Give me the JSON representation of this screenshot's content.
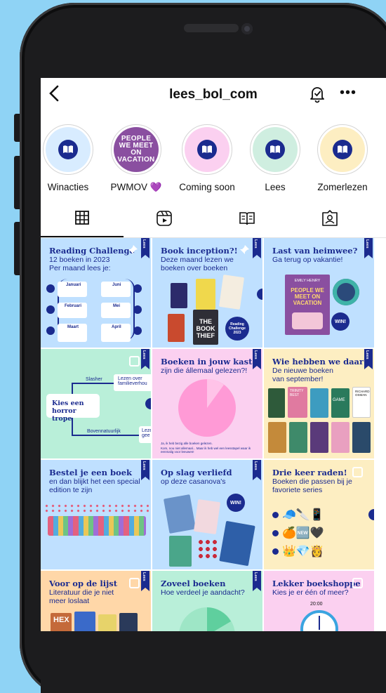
{
  "header": {
    "handle": "lees_bol_com"
  },
  "highlights": [
    {
      "label": "Winacties",
      "bg": "#d8ecff"
    },
    {
      "label": "PWMOV 💜",
      "bg": "#8a4fa0",
      "cover_text": "PEOPLE WE MEET ON VACATION"
    },
    {
      "label": "Coming soon",
      "bg": "#fbd0f0"
    },
    {
      "label": "Lees",
      "bg": "#cfeee0"
    },
    {
      "label": "Zomerlezen",
      "bg": "#fdeec2"
    }
  ],
  "tabs": [
    "grid-icon",
    "reels-icon",
    "guides-icon",
    "tagged-icon"
  ],
  "posts": [
    {
      "title": "Reading Challenge",
      "sub": "12 boeken in 2023\nPer maand lees je:",
      "bg": "#bfe0ff",
      "details": {
        "months": [
          "Januari",
          "Juni",
          "Februari",
          "Mei",
          "Maart",
          "April"
        ]
      }
    },
    {
      "title": "Book inception?!",
      "sub": "Deze maand lezen we boeken over boeken",
      "bg": "#bfe0ff",
      "details": {
        "badge": "Reading Challenge 2023",
        "book": "THE BOOK THIEF"
      }
    },
    {
      "title": "Last van heimwee?",
      "sub": "Ga terug op vakantie!",
      "bg": "#bfe0ff",
      "details": {
        "author": "EMILY HENRY",
        "book": "PEOPLE WE MEET ON VACATION",
        "badge": "WIN!"
      }
    },
    {
      "title": "",
      "sub": "",
      "bg": "#b9efd9",
      "details": {
        "center": "Kies een horror trope",
        "labels": [
          "Slasher",
          "Lezen over familieverhou",
          "Bovennatuurlijk",
          "Leze gee"
        ]
      }
    },
    {
      "title": "Boeken in jouw kast",
      "sub": "zijn die állemaal gelezen?!",
      "bg": "#fbd0f0",
      "details": {
        "legend": [
          "Ja, ik heb bezig alle boeken gelezen.",
          "Kom, nou niet allemaal... Maar ik heb wel een leesstapel waar ik eenmalig voor leeuwen!"
        ]
      }
    },
    {
      "title": "Wie hebben we daar?",
      "sub": "De nieuwe boeken van september!",
      "bg": "#fdeec2",
      "details": {
        "books": [
          "TRINITY BEST",
          "GAME",
          "RICHARD OSMAN"
        ]
      }
    },
    {
      "title": "Bestel je een boek",
      "sub": "en dan blijkt het een special edition te zijn",
      "bg": "#bfe0ff"
    },
    {
      "title": "Op slag verliefd",
      "sub": "op deze casanova's",
      "bg": "#bfe0ff",
      "details": {
        "badge": "WIN!"
      }
    },
    {
      "title": "Drie keer raden!",
      "sub": "Boeken die passen bij je favoriete series",
      "bg": "#fdeec2"
    },
    {
      "title": "Voor op de lijst",
      "sub": "Literatuur die je niet meer loslaat",
      "bg": "#ffd7a8",
      "details": {
        "book": "HEX"
      }
    },
    {
      "title": "Zoveel boeken",
      "sub": "Hoe verdeel je aandacht?",
      "bg": "#b9efd9"
    },
    {
      "title": "Lekker boekshoppe",
      "sub": "Kies je er één of meer?",
      "bg": "#fbd0f0",
      "details": {
        "clock": "20:00"
      }
    }
  ],
  "flag_text": "Lees",
  "colors": {
    "navy": "#1b2b8f",
    "background": "#8fd3f5",
    "phone": "#1c1c1e"
  }
}
